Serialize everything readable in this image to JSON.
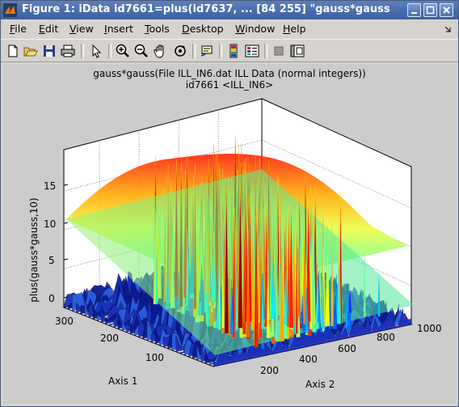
{
  "window": {
    "title": "Figure 1: iData id7661=plus(id7637, ... [84  255] \"gauss*gauss"
  },
  "menubar": {
    "items": [
      {
        "key": "F",
        "rest": "ile"
      },
      {
        "key": "E",
        "rest": "dit"
      },
      {
        "key": "V",
        "rest": "iew"
      },
      {
        "key": "I",
        "rest": "nsert"
      },
      {
        "key": "T",
        "rest": "ools"
      },
      {
        "key": "D",
        "rest": "esktop"
      },
      {
        "key": "W",
        "rest": "indow"
      },
      {
        "key": "H",
        "rest": "elp"
      }
    ]
  },
  "plot": {
    "title_line1": "gauss*gauss(File ILL_IN6.dat ILL Data (normal integers))",
    "title_line2": "id7661 <ILL_IN6>",
    "zlabel": "plus(gauss*gauss,10)",
    "xlabel": "Axis 1",
    "ylabel": "Axis 2",
    "z_ticks": [
      "0",
      "5",
      "10",
      "15"
    ],
    "axis1_ticks": [
      "300",
      "200",
      "100"
    ],
    "axis2_ticks": [
      "200",
      "400",
      "600",
      "800",
      "1000"
    ]
  },
  "chart_data": {
    "type": "surface",
    "title": "gauss*gauss(File ILL_IN6.dat ILL Data (normal integers))",
    "subtitle": "id7661 <ILL_IN6>",
    "zlabel": "plus(gauss*gauss,10)",
    "xlabel": "Axis 1",
    "ylabel": "Axis 2",
    "xlim": [
      0,
      340
    ],
    "ylim": [
      100,
      1000
    ],
    "zlim": [
      0,
      19
    ],
    "x_ticks": [
      100,
      200,
      300
    ],
    "y_ticks": [
      200,
      400,
      600,
      800,
      1000
    ],
    "z_ticks": [
      0,
      5,
      10,
      15
    ],
    "series": [
      {
        "name": "gauss*gauss",
        "shape": "smooth gaussian dome",
        "peak_z": 17
      },
      {
        "name": "plus(gauss*gauss,10)",
        "shape": "noisy spiky surface",
        "z_range": [
          0,
          19
        ]
      }
    ],
    "grid": true,
    "colormap": "jet"
  }
}
